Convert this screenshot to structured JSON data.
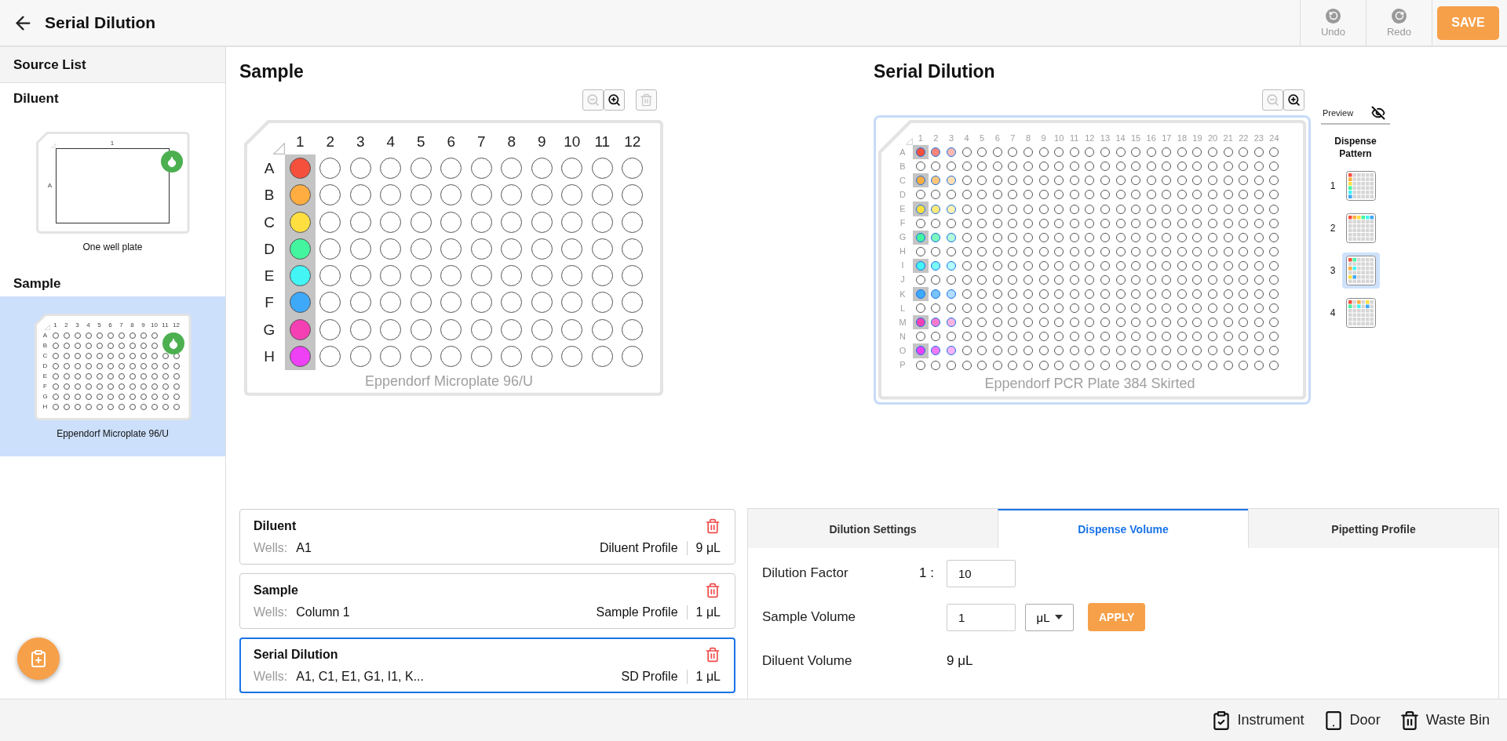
{
  "header": {
    "title": "Serial Dilution",
    "actions": [
      {
        "label": "Undo",
        "kind": "undo",
        "disabled": true
      },
      {
        "label": "Redo",
        "kind": "redo",
        "disabled": true
      }
    ],
    "save": "SAVE"
  },
  "source_list": {
    "title": "Source List",
    "groups": [
      {
        "label": "Diluent",
        "selected": false,
        "plate": {
          "kind": "single",
          "name": "One well plate",
          "columns": [
            "1"
          ],
          "rows": [
            "A"
          ]
        }
      },
      {
        "label": "Sample",
        "selected": true,
        "plate": {
          "kind": "grid",
          "name": "Eppendorf Microplate 96/U",
          "columns": [
            "1",
            "2",
            "3",
            "4",
            "5",
            "6",
            "7",
            "8",
            "9",
            "10",
            "11",
            "12"
          ],
          "rows": [
            "A",
            "B",
            "C",
            "D",
            "E",
            "F",
            "G",
            "H"
          ]
        }
      }
    ]
  },
  "sample": {
    "title": "Sample",
    "tools": [
      {
        "kind": "zoom_out",
        "disabled": true
      },
      {
        "kind": "zoom_in",
        "disabled": false
      },
      {
        "kind": "delete",
        "disabled": true
      }
    ],
    "plate": {
      "name": "Eppendorf Microplate 96/U",
      "selected": false,
      "columns": [
        {
          "label": "1",
          "selected": true,
          "filled": true
        },
        {
          "label": "2",
          "selected": false,
          "filled": false
        },
        {
          "label": "3",
          "selected": false,
          "filled": false
        },
        {
          "label": "4",
          "selected": false,
          "filled": false
        },
        {
          "label": "5",
          "selected": false,
          "filled": false
        },
        {
          "label": "6",
          "selected": false,
          "filled": false
        },
        {
          "label": "7",
          "selected": false,
          "filled": false
        },
        {
          "label": "8",
          "selected": false,
          "filled": false
        },
        {
          "label": "9",
          "selected": false,
          "filled": false
        },
        {
          "label": "10",
          "selected": false,
          "filled": false
        },
        {
          "label": "11",
          "selected": false,
          "filled": false
        },
        {
          "label": "12",
          "selected": false,
          "filled": false
        }
      ],
      "rows": [
        {
          "label": "A",
          "color": "#f5503c"
        },
        {
          "label": "B",
          "color": "#ffad40"
        },
        {
          "label": "C",
          "color": "#ffdf40"
        },
        {
          "label": "D",
          "color": "#44f59f"
        },
        {
          "label": "E",
          "color": "#44f5f5"
        },
        {
          "label": "F",
          "color": "#3fa9f9"
        },
        {
          "label": "G",
          "color": "#f540b4"
        },
        {
          "label": "H",
          "color": "#ee40f5"
        }
      ]
    }
  },
  "serial_dilution": {
    "title": "Serial Dilution",
    "tools": [
      {
        "kind": "zoom_out",
        "disabled": true
      },
      {
        "kind": "zoom_in",
        "disabled": false
      }
    ],
    "plate": {
      "name": "Eppendorf PCR Plate 384 Skirted",
      "selected": true,
      "columns": [
        {
          "label": "1",
          "selected": true,
          "filled": true
        },
        {
          "label": "2",
          "selected": false,
          "filled": true
        },
        {
          "label": "3",
          "selected": false,
          "filled": true
        },
        {
          "label": "4",
          "selected": false,
          "filled": false
        },
        {
          "label": "5",
          "selected": false,
          "filled": false
        },
        {
          "label": "6",
          "selected": false,
          "filled": false
        },
        {
          "label": "7",
          "selected": false,
          "filled": false
        },
        {
          "label": "8",
          "selected": false,
          "filled": false
        },
        {
          "label": "9",
          "selected": false,
          "filled": false
        },
        {
          "label": "10",
          "selected": false,
          "filled": false
        },
        {
          "label": "11",
          "selected": false,
          "filled": false
        },
        {
          "label": "12",
          "selected": false,
          "filled": false
        },
        {
          "label": "13",
          "selected": false,
          "filled": false
        },
        {
          "label": "14",
          "selected": false,
          "filled": false
        },
        {
          "label": "15",
          "selected": false,
          "filled": false
        },
        {
          "label": "16",
          "selected": false,
          "filled": false
        },
        {
          "label": "17",
          "selected": false,
          "filled": false
        },
        {
          "label": "18",
          "selected": false,
          "filled": false
        },
        {
          "label": "19",
          "selected": false,
          "filled": false
        },
        {
          "label": "20",
          "selected": false,
          "filled": false
        },
        {
          "label": "21",
          "selected": false,
          "filled": false
        },
        {
          "label": "22",
          "selected": false,
          "filled": false
        },
        {
          "label": "23",
          "selected": false,
          "filled": false
        },
        {
          "label": "24",
          "selected": false,
          "filled": false
        }
      ],
      "rows": [
        {
          "label": "A",
          "color": "#f5503c"
        },
        {
          "label": "B"
        },
        {
          "label": "C",
          "color": "#ffad40"
        },
        {
          "label": "D"
        },
        {
          "label": "E",
          "color": "#ffdf40"
        },
        {
          "label": "F"
        },
        {
          "label": "G",
          "color": "#44f59f"
        },
        {
          "label": "H"
        },
        {
          "label": "I",
          "color": "#44f5f5"
        },
        {
          "label": "J"
        },
        {
          "label": "K",
          "color": "#3fa9f9"
        },
        {
          "label": "L"
        },
        {
          "label": "M",
          "color": "#f540b4"
        },
        {
          "label": "N"
        },
        {
          "label": "O",
          "color": "#ee40f5"
        },
        {
          "label": "P"
        }
      ]
    },
    "preview": {
      "label": "Preview",
      "visible": false
    },
    "dispense_pattern": {
      "title": "Dispense Pattern",
      "options": [
        {
          "label": "1",
          "kind": "column",
          "selected": false
        },
        {
          "label": "2",
          "kind": "row",
          "selected": false
        },
        {
          "label": "3",
          "kind": "pairs",
          "selected": true
        },
        {
          "label": "4",
          "kind": "interleaved",
          "selected": false
        }
      ]
    }
  },
  "steps": [
    {
      "title": "Diluent",
      "wells_label": "Wells:",
      "wells": "A1",
      "profile": "Diluent Profile",
      "volume": "9 μL",
      "selected": false
    },
    {
      "title": "Sample",
      "wells_label": "Wells:",
      "wells": "Column 1",
      "profile": "Sample Profile",
      "volume": "1 μL",
      "selected": false
    },
    {
      "title": "Serial Dilution",
      "wells_label": "Wells:",
      "wells": "A1, C1, E1, G1, I1, K...",
      "profile": "SD Profile",
      "volume": "1 μL",
      "selected": true
    }
  ],
  "settings": {
    "tabs": [
      {
        "label": "Dilution Settings",
        "selected": false
      },
      {
        "label": "Dispense Volume",
        "selected": true
      },
      {
        "label": "Pipetting Profile",
        "selected": false
      }
    ],
    "dilution_factor": {
      "label": "Dilution Factor",
      "prefix": "1 :",
      "value": "10"
    },
    "sample_volume": {
      "label": "Sample Volume",
      "value": "1",
      "unit": "μL",
      "button": "APPLY"
    },
    "diluent_volume": {
      "label": "Diluent Volume",
      "value": "9 μL"
    }
  },
  "status_bar": [
    {
      "label": "Instrument",
      "kind": "instrument"
    },
    {
      "label": "Door",
      "kind": "door"
    },
    {
      "label": "Waste Bin",
      "kind": "waste"
    }
  ]
}
